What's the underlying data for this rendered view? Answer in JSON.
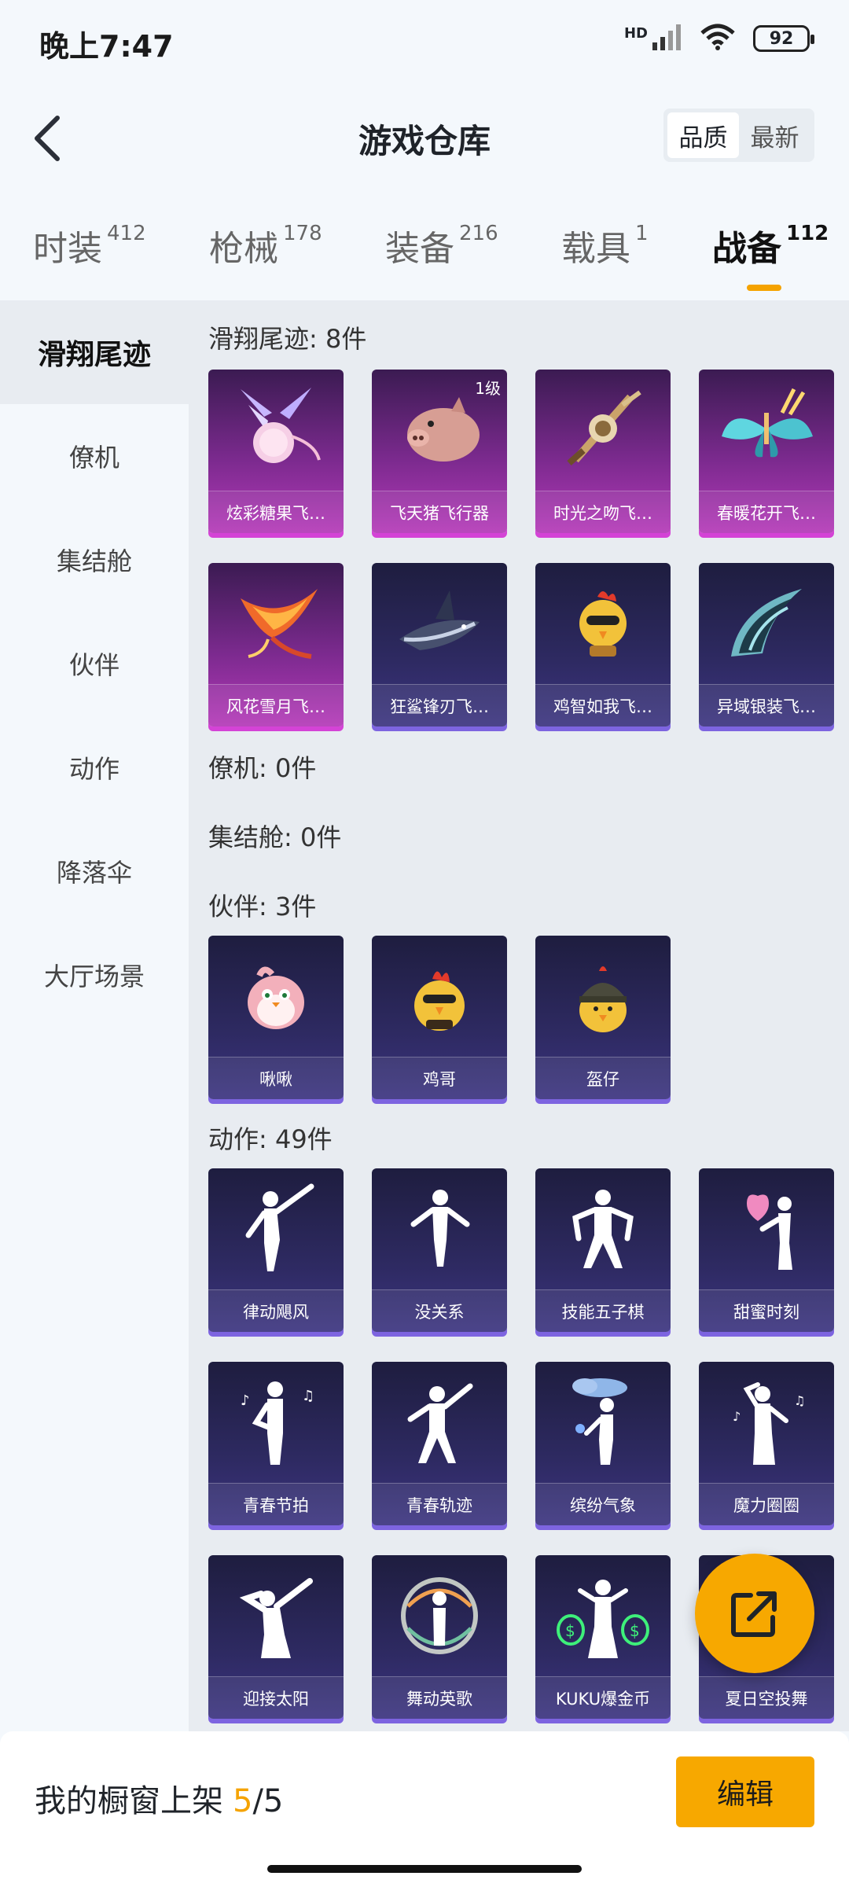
{
  "status_bar": {
    "time": "晚上7:47",
    "battery": "92",
    "network": "HD"
  },
  "header": {
    "title": "游戏仓库",
    "sort_options": [
      "品质",
      "最新"
    ],
    "active_sort": "品质"
  },
  "tabs": [
    {
      "label": "时装",
      "count": "412"
    },
    {
      "label": "枪械",
      "count": "178"
    },
    {
      "label": "装备",
      "count": "216"
    },
    {
      "label": "载具",
      "count": "1"
    },
    {
      "label": "战备",
      "count": "112",
      "active": true
    }
  ],
  "sidebar": [
    "滑翔尾迹",
    "僚机",
    "集结舱",
    "伙伴",
    "动作",
    "降落伞",
    "大厅场景"
  ],
  "sections": {
    "glide_trails": {
      "title": "滑翔尾迹: 8件",
      "items": [
        {
          "name": "炫彩糖果飞…",
          "icon": "candy-trail-icon"
        },
        {
          "name": "飞天猪飞行器",
          "icon": "flying-pig-icon",
          "level": "1级"
        },
        {
          "name": "时光之吻飞…",
          "icon": "time-kiss-icon"
        },
        {
          "name": "春暖花开飞…",
          "icon": "butterfly-icon"
        },
        {
          "name": "风花雪月飞…",
          "icon": "phoenix-icon"
        },
        {
          "name": "狂鲨锋刃飞…",
          "icon": "shark-icon"
        },
        {
          "name": "鸡智如我飞…",
          "icon": "chicken-icon"
        },
        {
          "name": "异域银装飞…",
          "icon": "silver-wing-icon"
        }
      ]
    },
    "wingman": {
      "title": "僚机: 0件"
    },
    "capsule": {
      "title": "集结舱: 0件"
    },
    "partners": {
      "title": "伙伴: 3件",
      "items": [
        {
          "name": "啾啾",
          "icon": "pink-bird-icon"
        },
        {
          "name": "鸡哥",
          "icon": "rooster-icon"
        },
        {
          "name": "盔仔",
          "icon": "helmet-chick-icon"
        }
      ]
    },
    "emotes": {
      "title": "动作: 49件",
      "items": [
        {
          "name": "律动飓风",
          "icon": "dance-pose-icon"
        },
        {
          "name": "没关系",
          "icon": "dance-pose-icon"
        },
        {
          "name": "技能五子棋",
          "icon": "dance-pose-icon"
        },
        {
          "name": "甜蜜时刻",
          "icon": "heart-pose-icon"
        },
        {
          "name": "青春节拍",
          "icon": "music-pose-icon"
        },
        {
          "name": "青春轨迹",
          "icon": "dance-pose-icon"
        },
        {
          "name": "缤纷气象",
          "icon": "cloud-pose-icon"
        },
        {
          "name": "魔力圈圈",
          "icon": "music-pose-icon"
        },
        {
          "name": "迎接太阳",
          "icon": "dab-pose-icon"
        },
        {
          "name": "舞动英歌",
          "icon": "swirl-pose-icon"
        },
        {
          "name": "KUKU爆金币",
          "icon": "money-pose-icon"
        },
        {
          "name": "夏日空投舞",
          "icon": "dance-pose-icon"
        }
      ]
    }
  },
  "bottom_bar": {
    "label": "我的橱窗上架",
    "count_current": "5",
    "count_total": "/5",
    "edit_label": "编辑"
  },
  "colors": {
    "accent": "#f7a800",
    "rare_card": "#b439b8",
    "epic_card": "#3c3480"
  }
}
